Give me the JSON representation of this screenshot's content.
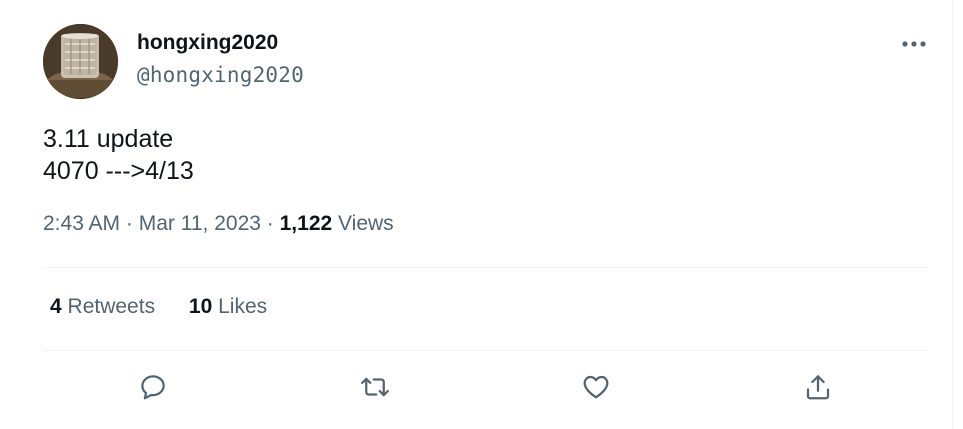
{
  "author": {
    "display_name": "hongxing2020",
    "handle": "@hongxing2020",
    "avatar_icon": "glass-photo-avatar"
  },
  "more_icon": "more-horizontal-icon",
  "tweet": {
    "lines": [
      "3.11 update",
      "4070 --->4/13"
    ]
  },
  "meta": {
    "time": "2:43 AM",
    "separator": "·",
    "date": "Mar 11, 2023",
    "views_count": "1,122",
    "views_label": "Views"
  },
  "stats": {
    "retweets_count": "4",
    "retweets_label": "Retweets",
    "likes_count": "10",
    "likes_label": "Likes"
  },
  "actions": [
    {
      "name": "reply",
      "icon": "reply-icon"
    },
    {
      "name": "retweet",
      "icon": "retweet-icon"
    },
    {
      "name": "like",
      "icon": "heart-icon"
    },
    {
      "name": "share",
      "icon": "share-icon"
    }
  ],
  "colors": {
    "text": "#0f1419",
    "secondary": "#536471",
    "divider": "#eff3f4"
  }
}
